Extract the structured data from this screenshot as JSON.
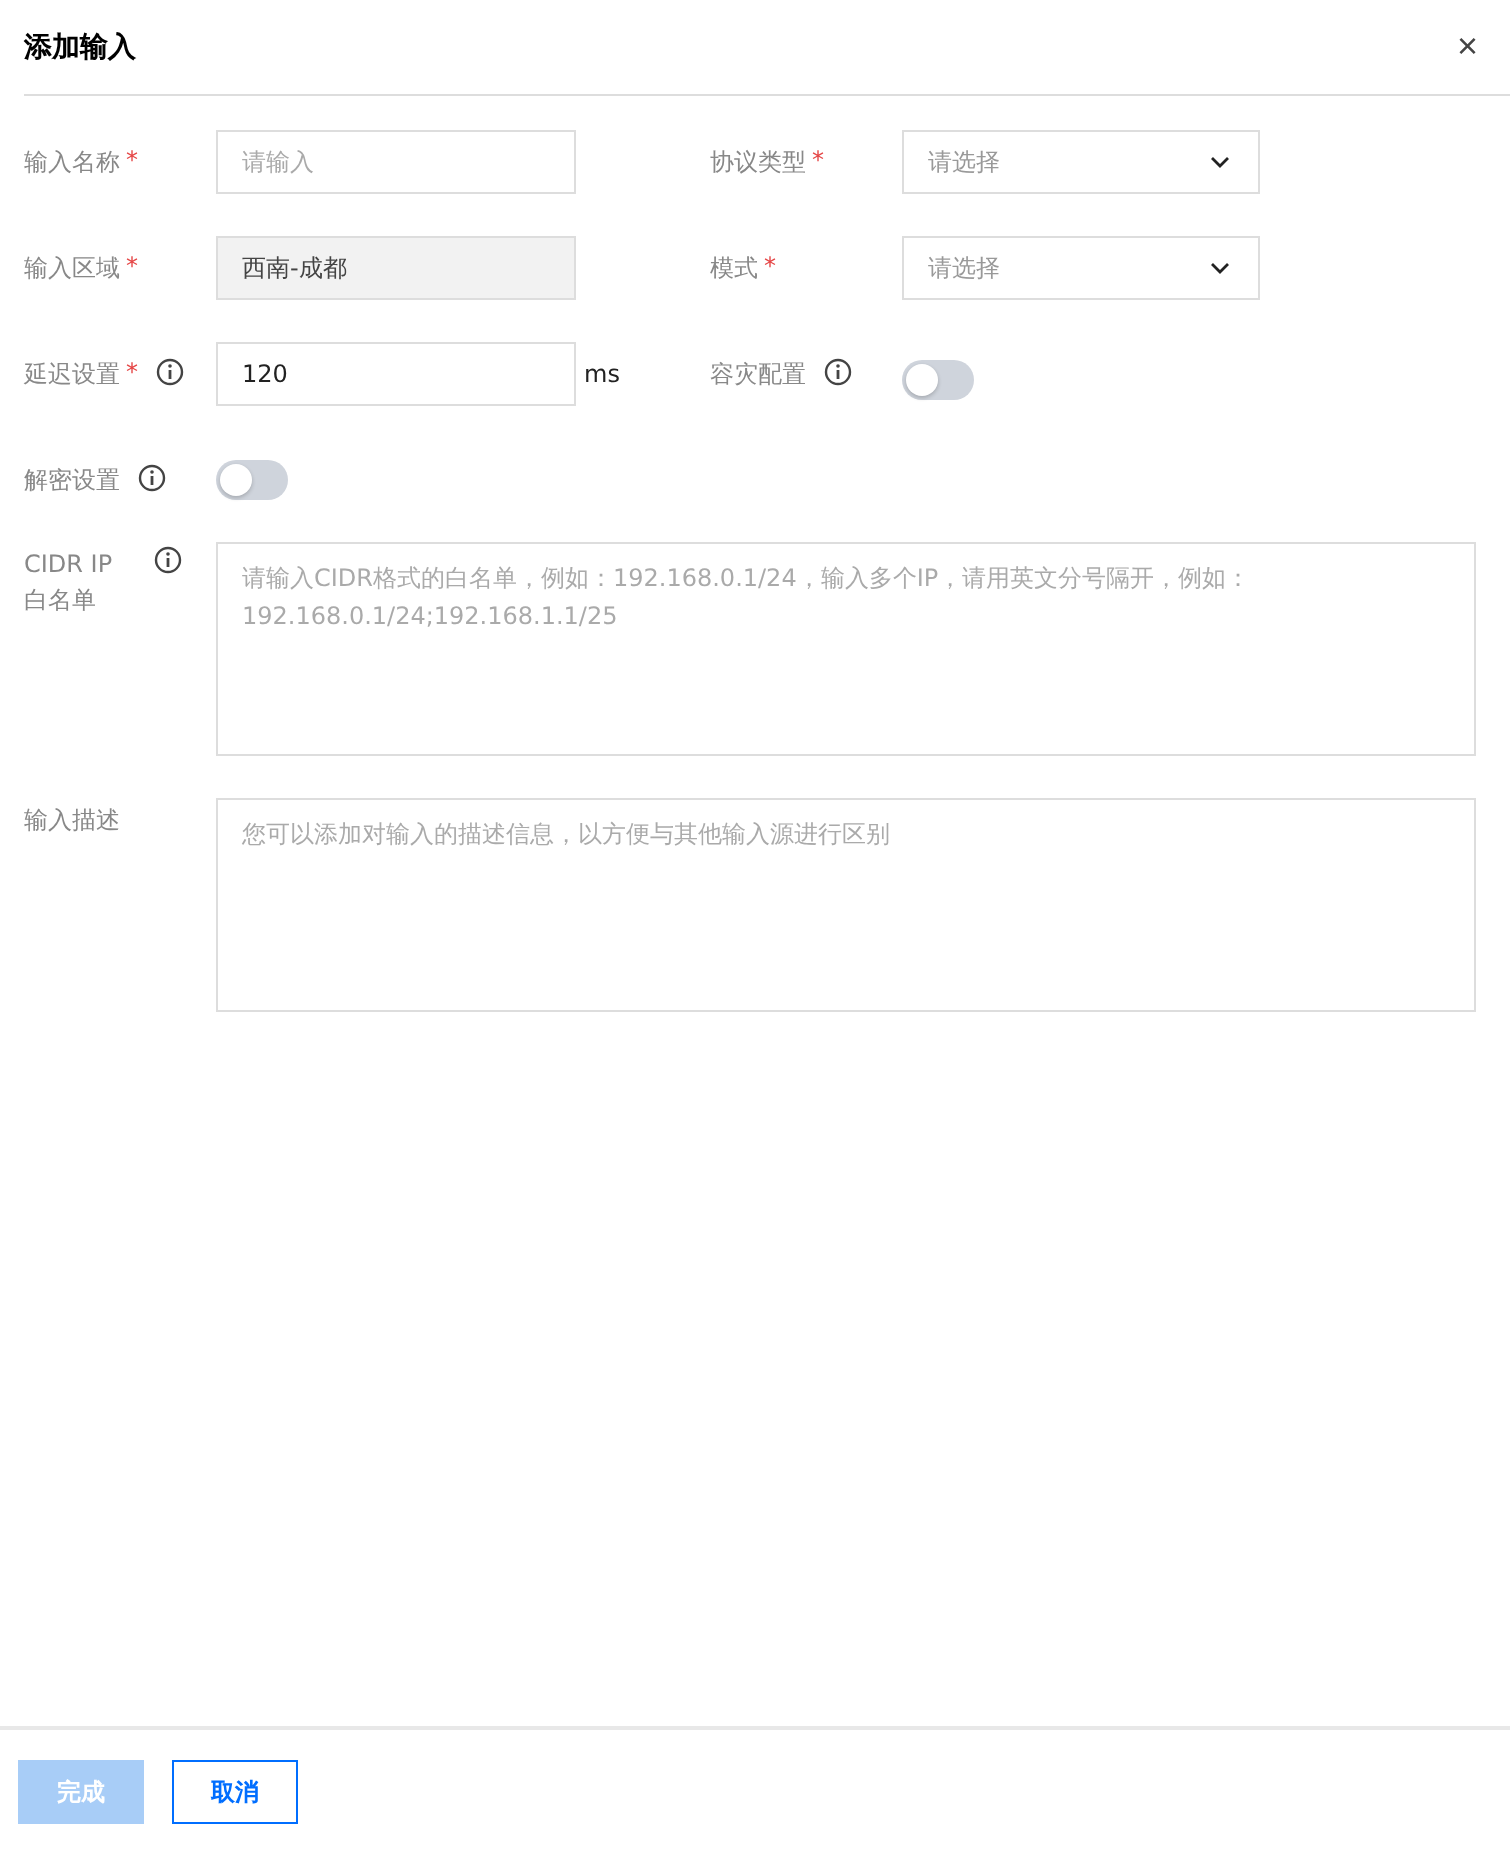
{
  "dialog": {
    "title": "添加输入",
    "close": "×"
  },
  "rows": [
    [
      {
        "kind": "input",
        "label": "输入名称",
        "required_mark": "*",
        "placeholder": "请输入",
        "disabled": false
      },
      {
        "kind": "select",
        "label": "协议类型",
        "required_mark": "*",
        "placeholder": "请选择"
      }
    ],
    [
      {
        "kind": "input",
        "label": "输入区域",
        "required_mark": "*",
        "value": "西南-成都",
        "disabled": true
      },
      {
        "kind": "select",
        "label": "模式",
        "required_mark": "*",
        "placeholder": "请选择"
      }
    ],
    [
      {
        "kind": "input",
        "label": "延迟设置",
        "required_mark": "*",
        "info": true,
        "value": "120",
        "suffix": "ms",
        "disabled": false
      },
      {
        "kind": "toggle",
        "label": "容灾配置",
        "info": true,
        "on": false
      }
    ],
    [
      {
        "kind": "toggle",
        "label": "解密设置",
        "info": true,
        "on": false
      }
    ],
    [
      {
        "kind": "textarea",
        "label": "CIDR IP 白名单",
        "info": true,
        "placeholder": "请输入CIDR格式的白名单，例如：192.168.0.1/24，输入多个IP，请用英文分号隔开，例如：192.168.0.1/24;192.168.1.1/25"
      }
    ],
    [
      {
        "kind": "textarea",
        "label": "输入描述",
        "placeholder": "您可以添加对输入的描述信息，以方便与其他输入源进行区别"
      }
    ]
  ],
  "buttons": [
    {
      "label": "完成",
      "kind": "primary",
      "disabled": true
    },
    {
      "label": "取消",
      "kind": "secondary",
      "disabled": false
    }
  ]
}
